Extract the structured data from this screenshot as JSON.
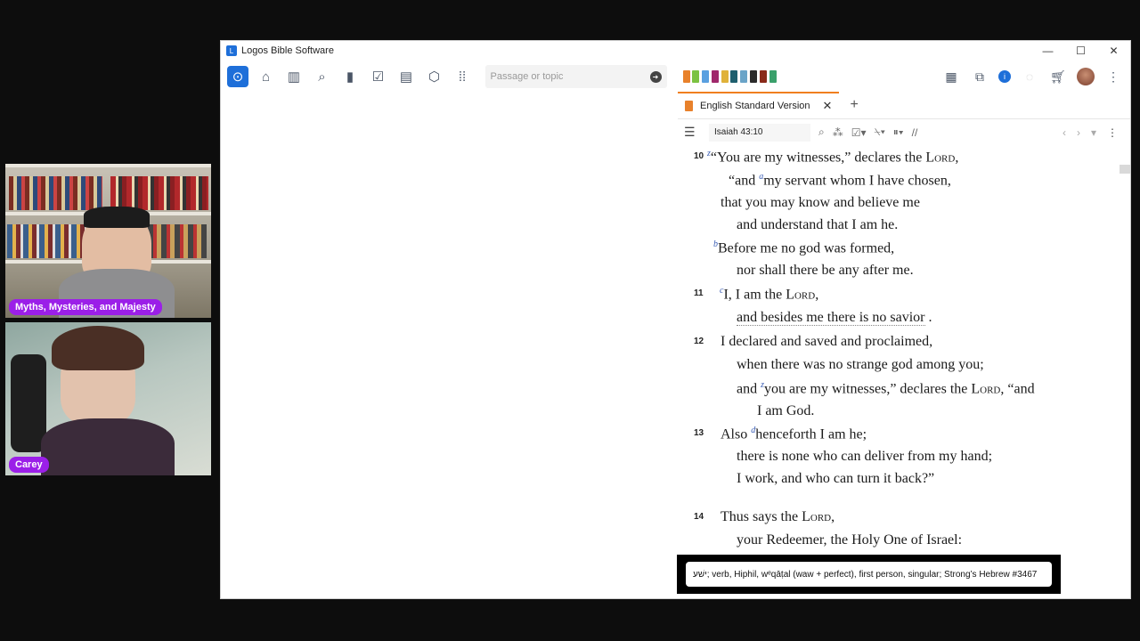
{
  "webcams": [
    {
      "label": "Myths, Mysteries, and Majesty"
    },
    {
      "label": "Carey"
    }
  ],
  "window": {
    "title": "Logos Bible Software",
    "controls": [
      "—",
      "☐",
      "✕"
    ]
  },
  "toolbar": {
    "search_placeholder": "Passage or topic",
    "icons": [
      "logos-home-icon",
      "home-icon",
      "library-icon",
      "search-icon",
      "bible-icon",
      "checklist-icon",
      "document-icon",
      "shield-icon",
      "apps-grid-icon"
    ],
    "right_icons": [
      "layout-icon",
      "popout-icon",
      "info-icon",
      "sync-icon",
      "cart-icon",
      "user-avatar-icon",
      "more-icon"
    ],
    "minibook_colors": [
      "#e8812b",
      "#7cc242",
      "#5aa0e0",
      "#a0286b",
      "#e0b23a",
      "#1f5f6e",
      "#6aa4c8",
      "#2b2b2b",
      "#8a2a1a",
      "#3aa06b"
    ]
  },
  "panel": {
    "tab_label": "English Standard Version",
    "reference": "Isaiah 43:10"
  },
  "verses": [
    {
      "num": "10",
      "lines": [
        {
          "fn": "z",
          "text": "“You are my witnesses,” declares the ",
          "sc": "Lord",
          "tail": ","
        },
        {
          "fn": "a",
          "pre": "“and ",
          "text": "my servant whom I have chosen,"
        },
        {
          "text": "that you may know and believe me"
        },
        {
          "text": "and understand that I am he."
        },
        {
          "fn": "b",
          "text": "Before me no god was formed,"
        },
        {
          "text": "nor shall there be any after me."
        }
      ]
    },
    {
      "num": "11",
      "lines": [
        {
          "fn": "c",
          "text": "I, I am the ",
          "sc": "Lord",
          "tail": ","
        },
        {
          "text": "and besides me there is no savior",
          "tail": " ."
        }
      ]
    },
    {
      "num": "12",
      "lines": [
        {
          "text": "I declared and saved and proclaimed,"
        },
        {
          "text": "when there was no strange god among you;"
        },
        {
          "pre": "and ",
          "fn": "z",
          "text": "you are my witnesses,” declares the ",
          "sc": "Lord",
          "tail": ", “and"
        },
        {
          "text": "I am God."
        }
      ]
    },
    {
      "num": "13",
      "lines": [
        {
          "pre": "Also ",
          "fn": "d",
          "text": "henceforth I am he;"
        },
        {
          "text": "there is none who can deliver from my hand;"
        },
        {
          "text": "I work, and who can turn it back?”"
        }
      ]
    },
    {
      "num": "14",
      "lines": [
        {
          "text": "Thus says the ",
          "sc": "Lord",
          "tail": ","
        },
        {
          "text": "your Redeemer, the Holy One of Israel:"
        }
      ]
    }
  ],
  "tooltip": {
    "text": "ישׁע; verb, Hiphil, wᵉqāṭal (waw + perfect), first person, singular; Strong’s Hebrew #3467"
  }
}
